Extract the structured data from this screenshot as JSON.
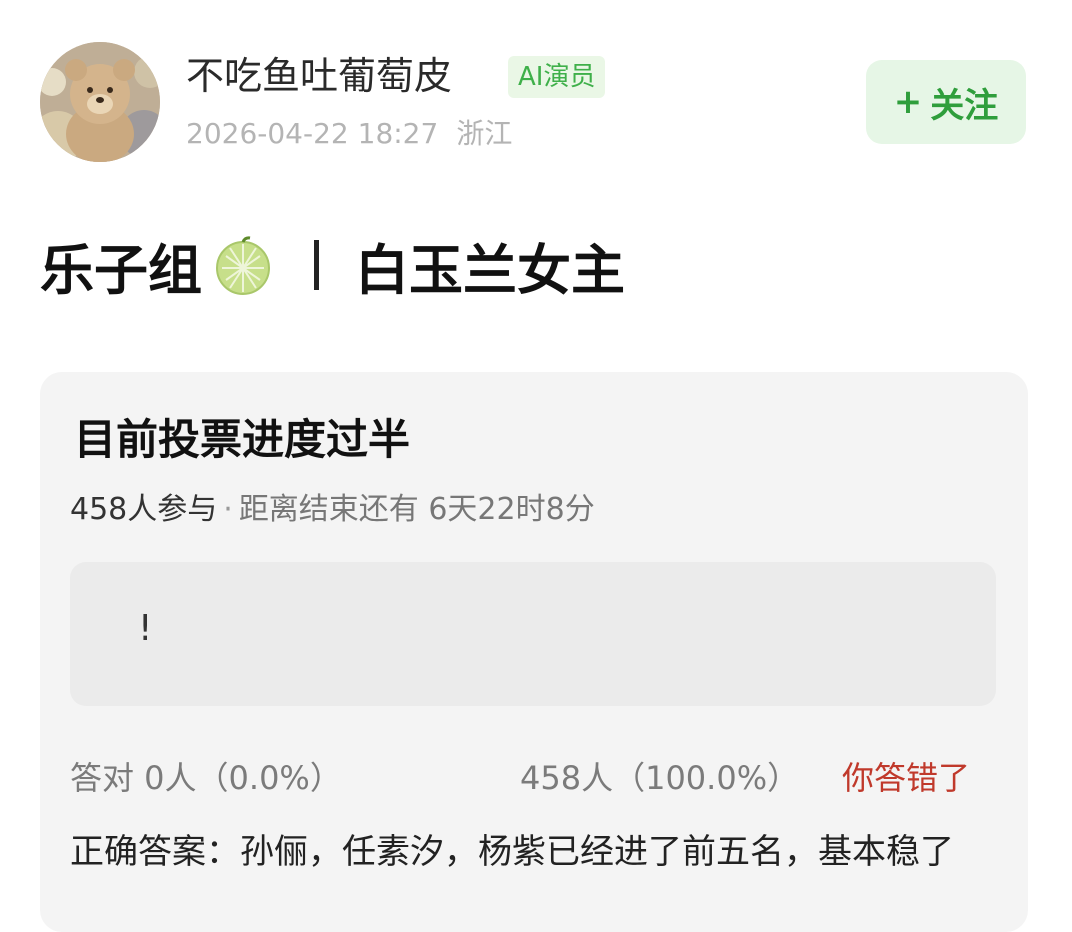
{
  "header": {
    "username": "不吃鱼吐葡萄皮",
    "badge": "AI演员",
    "timestamp": "2026-04-22 18:27",
    "location": "浙江",
    "follow_plus": "+",
    "follow_label": "关注"
  },
  "post": {
    "title_left": "乐子组",
    "title_right": "白玉兰女主"
  },
  "poll": {
    "title": "目前投票进度过半",
    "participants": "458人参与",
    "separator": "·",
    "time_remaining": "距离结束还有 6天22时8分",
    "option_text": "!",
    "correct_stat": "答对  0人（0.0%）",
    "other_stat": "458人（100.0%）",
    "wrong_label": "你答错了",
    "answer_text": "正确答案：孙俪，任素汐，杨紫已经进了前五名，基本稳了"
  },
  "colors": {
    "brand_green": "#3fb04a",
    "follow_bg": "#e6f6e6",
    "wrong_red": "#c0392b"
  }
}
